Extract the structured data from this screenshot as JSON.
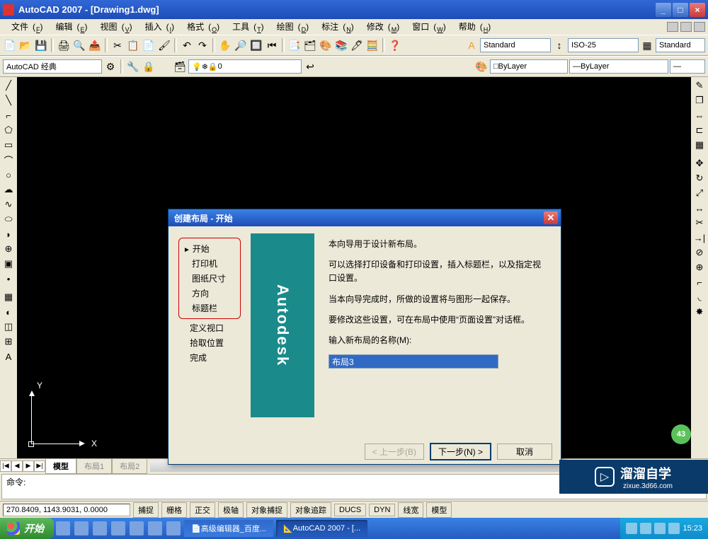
{
  "window": {
    "title": "AutoCAD 2007 - [Drawing1.dwg]"
  },
  "menus": [
    {
      "label": "文件",
      "key": "F"
    },
    {
      "label": "编辑",
      "key": "E"
    },
    {
      "label": "视图",
      "key": "V"
    },
    {
      "label": "插入",
      "key": "I"
    },
    {
      "label": "格式",
      "key": "O"
    },
    {
      "label": "工具",
      "key": "T"
    },
    {
      "label": "绘图",
      "key": "D"
    },
    {
      "label": "标注",
      "key": "N"
    },
    {
      "label": "修改",
      "key": "M"
    },
    {
      "label": "窗口",
      "key": "W"
    },
    {
      "label": "帮助",
      "key": "H"
    }
  ],
  "toolbar2": {
    "workspace": "AutoCAD 经典",
    "layer": "0",
    "bylayer1": "ByLayer",
    "bylayer2": "ByLayer",
    "standard1": "Standard",
    "iso25": "ISO-25",
    "standard2": "Standard"
  },
  "ucs": {
    "x": "X",
    "y": "Y"
  },
  "badge": "43",
  "tabs": {
    "model": "模型",
    "layout1": "布局1",
    "layout2": "布局2"
  },
  "cmd": {
    "prompt": "命令:"
  },
  "status": {
    "coords": "270.8409, 1143.9031, 0.0000",
    "buttons": [
      "捕捉",
      "栅格",
      "正交",
      "极轴",
      "对象捕捉",
      "对象追踪",
      "DUCS",
      "DYN",
      "线宽",
      "模型"
    ]
  },
  "taskbar": {
    "start": "开始",
    "tasks": [
      {
        "label": "高级编辑器_百度...",
        "active": false
      },
      {
        "label": "AutoCAD 2007 - [...",
        "active": true
      }
    ],
    "time": "15:23"
  },
  "dialog": {
    "title": "创建布局 - 开始",
    "nav_boxed": [
      "开始",
      "打印机",
      "图纸尺寸",
      "方向",
      "标题栏"
    ],
    "nav_rest": [
      "定义视口",
      "拾取位置",
      "完成"
    ],
    "logo": "Autodesk",
    "p1": "本向导用于设计新布局。",
    "p2": "可以选择打印设备和打印设置，插入标题栏，以及指定视口设置。",
    "p3": "当本向导完成时，所做的设置将与图形一起保存。",
    "p4": "要修改这些设置，可在布局中使用“页面设置”对话框。",
    "input_label": "输入新布局的名称(M):",
    "input_value": "布局3",
    "btn_back": "< 上一步(B)",
    "btn_next": "下一步(N) >",
    "btn_cancel": "取消"
  },
  "watermark": {
    "text": "溜溜自学",
    "sub": "zixue.3d66.com"
  }
}
